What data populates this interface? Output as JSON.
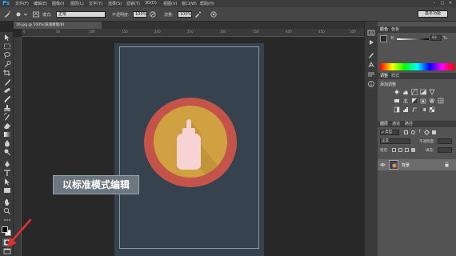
{
  "app": {
    "logo": "Ps"
  },
  "menu": {
    "items": [
      "文件(F)",
      "编辑(E)",
      "图像(I)",
      "图层(L)",
      "文字(Y)",
      "选择(S)",
      "滤镜(T)",
      "3D(D)",
      "视图(V)",
      "窗口(W)",
      "帮助(H)"
    ],
    "window_buttons": [
      "–",
      "□",
      "✕"
    ]
  },
  "options_bar": {
    "mode_label": "模式:",
    "mode_value": "正常",
    "opacity_label": "不透明度:",
    "opacity_value": "100%",
    "flow_label": "流量:",
    "flow_value": "100%",
    "workspace": "基本功能"
  },
  "document": {
    "tab_title": "16.jpg @ 100%(快速蒙版/8)",
    "ruler_ticks": [
      "0",
      "50",
      "100",
      "150",
      "200",
      "250",
      "300",
      "350",
      "400",
      "450",
      "500"
    ]
  },
  "annotation": {
    "text": "以标准模式编辑"
  },
  "colors": {
    "artboard": "#36434e",
    "ring": "#c4544a",
    "disc": "#cfa140",
    "bottle": "#f8d3d4",
    "arrow": "#e03030"
  },
  "right_panels": {
    "color_tabs": [
      "颜色",
      "色板"
    ],
    "color_channel": "K",
    "color_value": "83",
    "color_unit": "%",
    "adjust_tabs": [
      "调整",
      "样式"
    ],
    "adjust_title": "添加调整",
    "layer_tabs": [
      "图层",
      "通道",
      "路径"
    ],
    "layer_kind_label": "ρ 类型",
    "blend_mode": "正常",
    "opacity_label": "不透明度:",
    "lock_label": "锁定:",
    "fill_label": "填充:",
    "layer_name": "背景"
  },
  "icons": {
    "toolbar": [
      "move-icon",
      "marquee-icon",
      "lasso-icon",
      "quick-select-icon",
      "crop-icon",
      "eyedropper-icon",
      "healing-icon",
      "brush-icon",
      "stamp-icon",
      "history-brush-icon",
      "eraser-icon",
      "gradient-icon",
      "blur-icon",
      "dodge-icon",
      "pen-icon",
      "type-icon",
      "path-select-icon",
      "shape-icon",
      "hand-icon",
      "zoom-icon",
      "extras-icon"
    ],
    "strip": [
      "history-panel-icon",
      "actions-panel-icon",
      "brush-panel-icon",
      "character-panel-icon",
      "paragraph-panel-icon",
      "info-panel-icon"
    ]
  }
}
